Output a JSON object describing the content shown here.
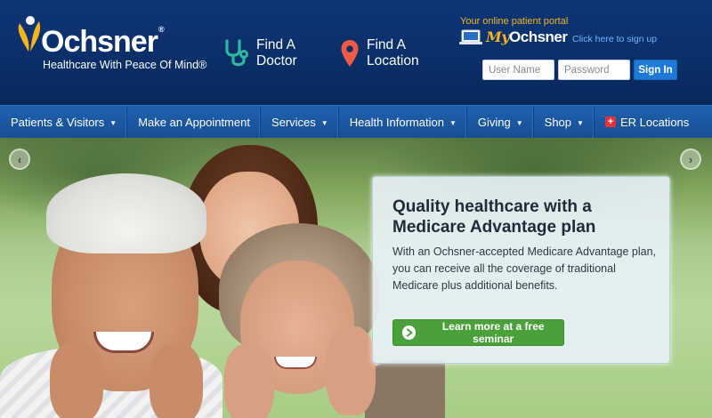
{
  "header": {
    "logo": {
      "name": "Ochsner",
      "reg": "®",
      "tagline": "Healthcare With Peace Of Mind®"
    },
    "find_doctor": {
      "line1": "Find A",
      "line2": "Doctor",
      "icon": "stethoscope-icon"
    },
    "find_location": {
      "line1": "Find A",
      "line2": "Location",
      "icon": "map-pin-icon"
    },
    "portal": {
      "caption": "Your online patient portal",
      "brand_my": "My",
      "brand_name": "Ochsner",
      "signup_link": "Click here to sign up",
      "username_placeholder": "User Name",
      "password_placeholder": "Password",
      "signin_label": "Sign In"
    }
  },
  "nav": {
    "items": [
      {
        "label": "Patients & Visitors",
        "dropdown": true
      },
      {
        "label": "Make an Appointment",
        "dropdown": false
      },
      {
        "label": "Services",
        "dropdown": true
      },
      {
        "label": "Health Information",
        "dropdown": true
      },
      {
        "label": "Giving",
        "dropdown": true
      },
      {
        "label": "Shop",
        "dropdown": true
      },
      {
        "label": "ER Locations",
        "dropdown": false
      }
    ]
  },
  "hero": {
    "promo": {
      "title": "Quality healthcare with a Medicare Advantage plan",
      "body": "With an Ochsner-accepted Medicare Advantage plan, you can receive all the coverage of traditional Medicare plus additional benefits.",
      "button_label": "Learn more at a free seminar"
    }
  },
  "colors": {
    "header_bg": "#0a2e68",
    "nav_bg": "#1a57a2",
    "accent_gold": "#f6b41b",
    "signin_blue": "#1e7ad6",
    "cta_green": "#4aa139",
    "er_red": "#e53239"
  }
}
